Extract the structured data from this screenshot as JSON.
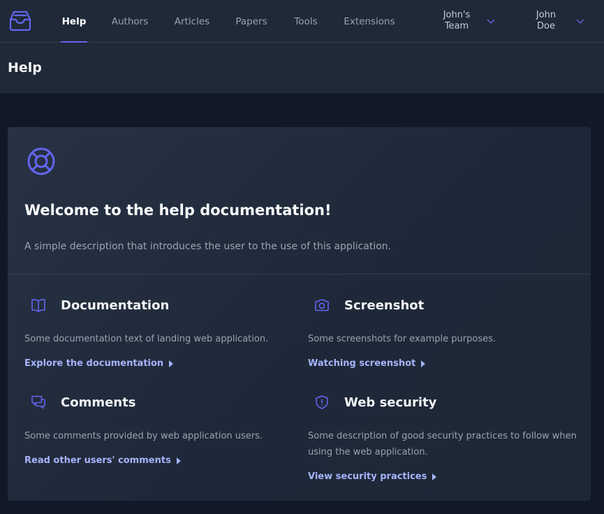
{
  "nav": {
    "items": [
      {
        "label": "Help",
        "active": true
      },
      {
        "label": "Authors",
        "active": false
      },
      {
        "label": "Articles",
        "active": false
      },
      {
        "label": "Papers",
        "active": false
      },
      {
        "label": "Tools",
        "active": false
      },
      {
        "label": "Extensions",
        "active": false
      }
    ],
    "team_menu": {
      "label": "John's Team",
      "icon": "chevron-down-icon"
    },
    "user_menu": {
      "label": "John Doe",
      "icon": "chevron-down-icon"
    },
    "logo_icon": "inbox-stack-logo"
  },
  "page": {
    "title": "Help"
  },
  "hero": {
    "icon": "lifebuoy-icon",
    "title": "Welcome to the help documentation!",
    "description": "A simple description that introduces the user to the use of this application."
  },
  "sections": [
    {
      "icon": "book-open-icon",
      "title": "Documentation",
      "text": "Some documentation text of landing web application.",
      "link": "Explore the documentation"
    },
    {
      "icon": "camera-icon",
      "title": "Screenshot",
      "text": "Some screenshots for example purposes.",
      "link": "Watching screenshot"
    },
    {
      "icon": "chat-bubbles-icon",
      "title": "Comments",
      "text": "Some comments provided by web application users.",
      "link": "Read other users' comments"
    },
    {
      "icon": "shield-icon",
      "title": "Web security",
      "text": "Some description of good security practices to follow when using the web application.",
      "link": "View security practices"
    }
  ],
  "colors": {
    "accent": "#6366f1",
    "link": "#a5b4fc",
    "background": "#111827",
    "panel": "#1f2937"
  }
}
